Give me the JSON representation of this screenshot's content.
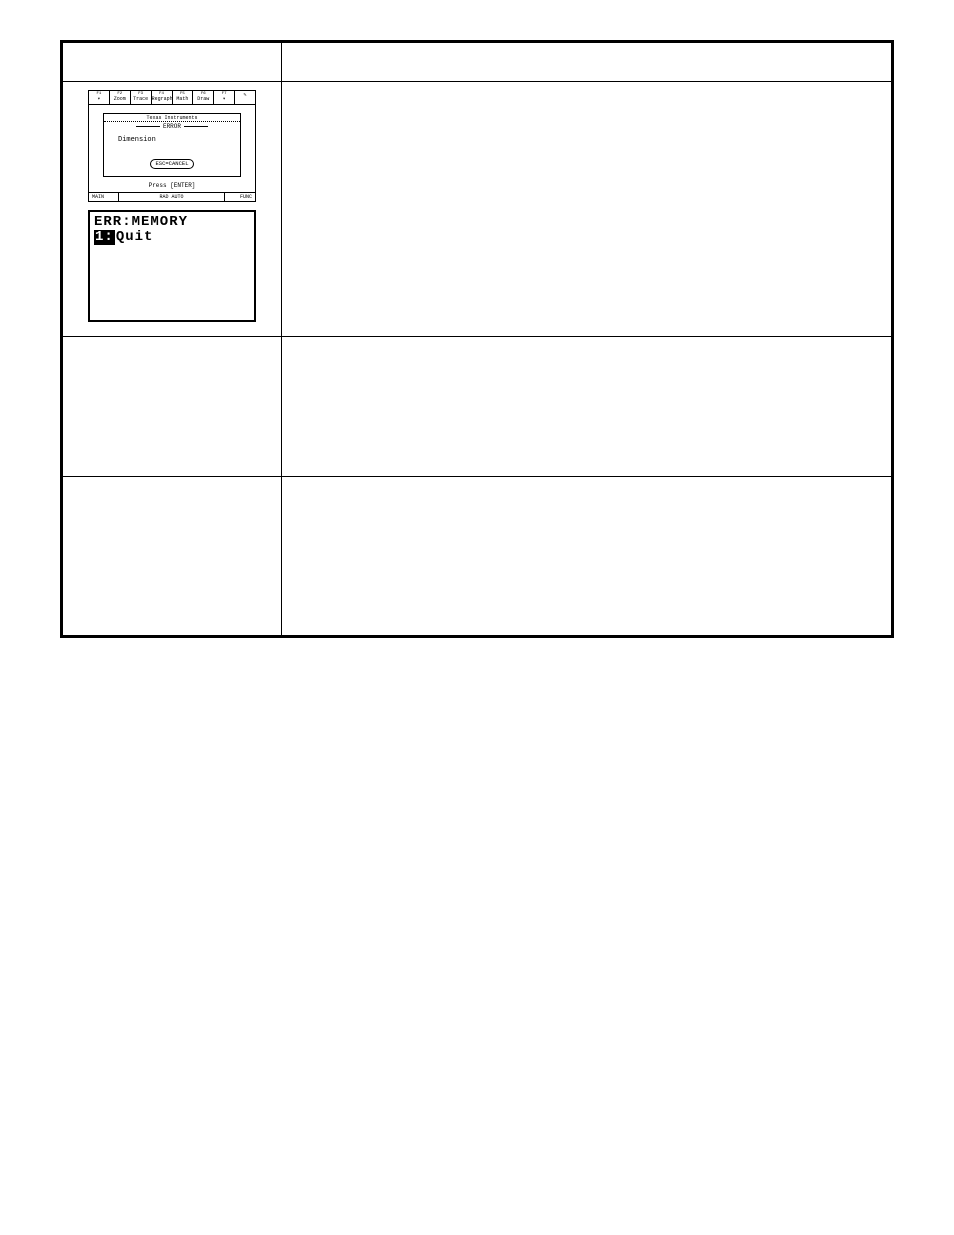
{
  "calc1": {
    "tabs_fkeys": [
      "F1",
      "F2",
      "F3",
      "F4",
      "F5",
      "F6",
      "F7"
    ],
    "tabs": [
      "▾",
      "Zoom",
      "Trace",
      "Regraph",
      "Math",
      "Draw",
      "▾",
      "✎"
    ],
    "banner": "Texas Instruments",
    "error_title": "ERROR",
    "error_msg": "Dimension",
    "esc_label": "ESC=CANCEL",
    "press_enter": "Press [ENTER]",
    "status_main": "MAIN",
    "status_mid": "RAD AUTO",
    "status_func": "FUNC"
  },
  "calc2": {
    "line1": "ERR:MEMORY",
    "sel": "1:",
    "quit": "Quit"
  }
}
